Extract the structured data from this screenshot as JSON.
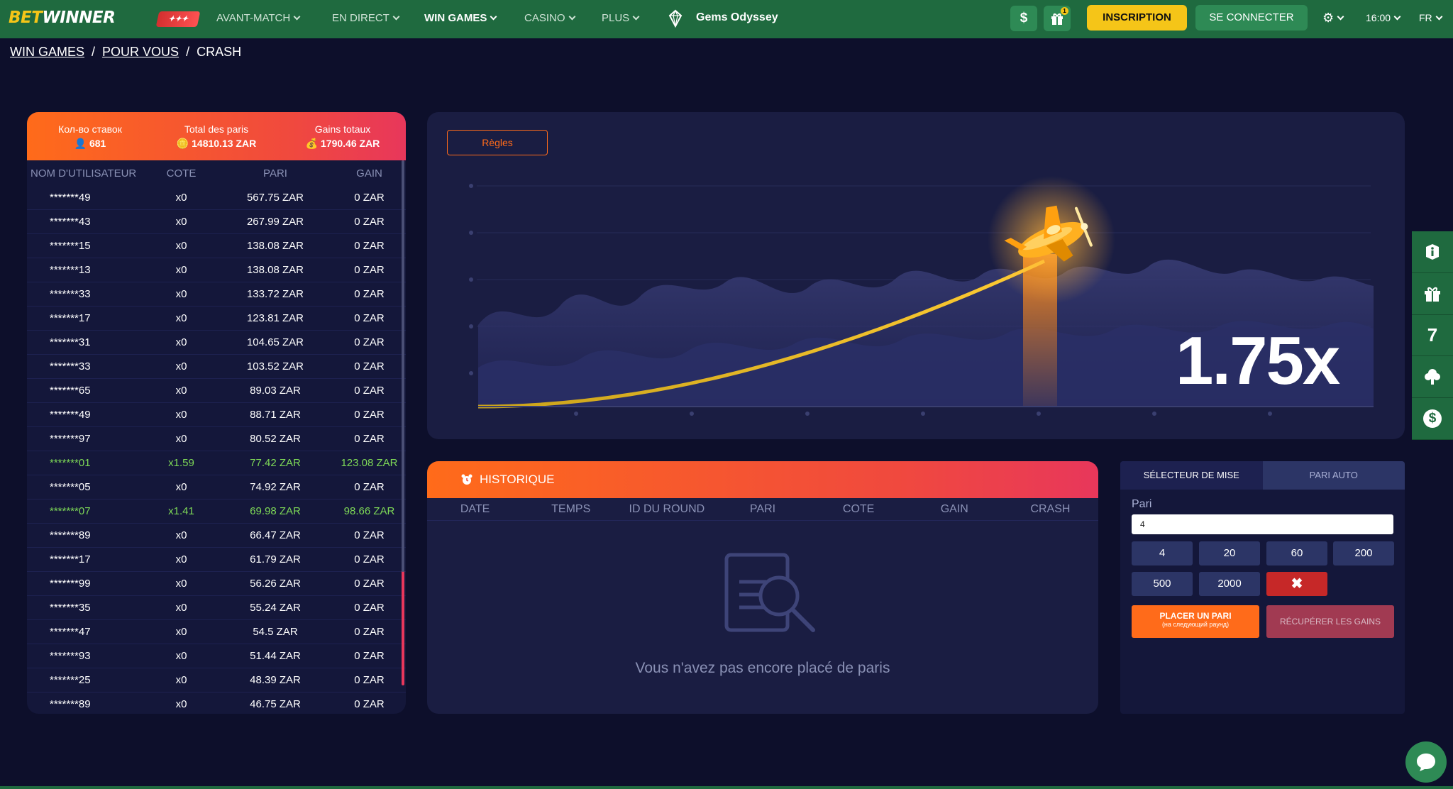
{
  "header": {
    "logo_bet": "BET",
    "logo_winner": "WINNER",
    "nav": [
      {
        "label": "AVANT-MATCH"
      },
      {
        "label": "EN DIRECT"
      },
      {
        "label": "WIN GAMES"
      },
      {
        "label": "CASINO"
      },
      {
        "label": "PLUS"
      }
    ],
    "game_title": "Gems Odyssey",
    "dollar_icon": "$",
    "gift_count": "1",
    "inscription": "INSCRIPTION",
    "connect": "SE CONNECTER",
    "time": "16:00",
    "lang": "FR"
  },
  "breadcrumb": {
    "win_games": "WIN GAMES",
    "sep1": "/",
    "pour_vous": "POUR VOUS",
    "sep2": "/",
    "crash": "CRASH"
  },
  "bets": {
    "stats": [
      {
        "label": "Кол-во ставок",
        "value": "681"
      },
      {
        "label": "Total des paris",
        "value": "14810.13 ZAR"
      },
      {
        "label": "Gains totaux",
        "value": "1790.46 ZAR"
      }
    ],
    "columns": {
      "user": "NOM D'UTILISATEUR",
      "cote": "COTE",
      "pari": "PARI",
      "gain": "GAIN"
    },
    "rows": [
      {
        "user": "*******49",
        "cote": "x0",
        "pari": "567.75 ZAR",
        "gain": "0 ZAR"
      },
      {
        "user": "*******43",
        "cote": "x0",
        "pari": "267.99 ZAR",
        "gain": "0 ZAR"
      },
      {
        "user": "*******15",
        "cote": "x0",
        "pari": "138.08 ZAR",
        "gain": "0 ZAR"
      },
      {
        "user": "*******13",
        "cote": "x0",
        "pari": "138.08 ZAR",
        "gain": "0 ZAR"
      },
      {
        "user": "*******33",
        "cote": "x0",
        "pari": "133.72 ZAR",
        "gain": "0 ZAR"
      },
      {
        "user": "*******17",
        "cote": "x0",
        "pari": "123.81 ZAR",
        "gain": "0 ZAR"
      },
      {
        "user": "*******31",
        "cote": "x0",
        "pari": "104.65 ZAR",
        "gain": "0 ZAR"
      },
      {
        "user": "*******33",
        "cote": "x0",
        "pari": "103.52 ZAR",
        "gain": "0 ZAR"
      },
      {
        "user": "*******65",
        "cote": "x0",
        "pari": "89.03 ZAR",
        "gain": "0 ZAR"
      },
      {
        "user": "*******49",
        "cote": "x0",
        "pari": "88.71 ZAR",
        "gain": "0 ZAR"
      },
      {
        "user": "*******97",
        "cote": "x0",
        "pari": "80.52 ZAR",
        "gain": "0 ZAR"
      },
      {
        "user": "*******01",
        "cote": "x1.59",
        "pari": "77.42 ZAR",
        "gain": "123.08 ZAR",
        "win": true
      },
      {
        "user": "*******05",
        "cote": "x0",
        "pari": "74.92 ZAR",
        "gain": "0 ZAR"
      },
      {
        "user": "*******07",
        "cote": "x1.41",
        "pari": "69.98 ZAR",
        "gain": "98.66 ZAR",
        "win": true
      },
      {
        "user": "*******89",
        "cote": "x0",
        "pari": "66.47 ZAR",
        "gain": "0 ZAR"
      },
      {
        "user": "*******17",
        "cote": "x0",
        "pari": "61.79 ZAR",
        "gain": "0 ZAR"
      },
      {
        "user": "*******99",
        "cote": "x0",
        "pari": "56.26 ZAR",
        "gain": "0 ZAR"
      },
      {
        "user": "*******35",
        "cote": "x0",
        "pari": "55.24 ZAR",
        "gain": "0 ZAR"
      },
      {
        "user": "*******47",
        "cote": "x0",
        "pari": "54.5 ZAR",
        "gain": "0 ZAR"
      },
      {
        "user": "*******93",
        "cote": "x0",
        "pari": "51.44 ZAR",
        "gain": "0 ZAR"
      },
      {
        "user": "*******25",
        "cote": "x0",
        "pari": "48.39 ZAR",
        "gain": "0 ZAR"
      },
      {
        "user": "*******89",
        "cote": "x0",
        "pari": "46.75 ZAR",
        "gain": "0 ZAR"
      }
    ]
  },
  "game": {
    "rules": "Règles",
    "multiplier": "1.75x"
  },
  "history": {
    "title": "HISTORIQUE",
    "columns": [
      "DATE",
      "TEMPS",
      "ID DU ROUND",
      "PARI",
      "COTE",
      "GAIN",
      "CRASH"
    ],
    "empty": "Vous n'avez pas encore placé de paris"
  },
  "bet_panel": {
    "tab_selector": "SÉLECTEUR DE MISE",
    "tab_auto": "PARI AUTO",
    "pari_label": "Pari",
    "pari_value": "4",
    "chips": [
      "4",
      "20",
      "60",
      "200",
      "500",
      "2000"
    ],
    "clear": "✖",
    "place_main": "PLACER UN PARI",
    "place_sub": "(на следующий раунд)",
    "collect": "RÉCUPÉRER LES GAINS"
  },
  "sidebar": {
    "seven": "7",
    "dollar": "$"
  },
  "colors": {
    "brand_green": "#1f6a3f",
    "accent_orange": "#ff6b1a",
    "accent_yellow": "#f5c518",
    "win_green": "#7ed957",
    "background": "#0d0f2b"
  }
}
